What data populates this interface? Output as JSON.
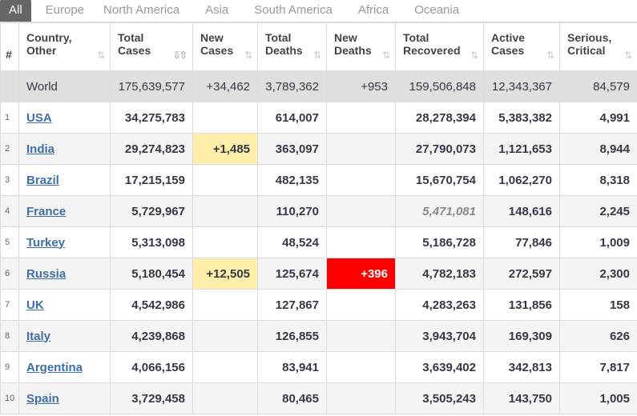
{
  "tabs": [
    "All",
    "Europe",
    "North America",
    "Asia",
    "South America",
    "Africa",
    "Oceania"
  ],
  "headers": {
    "idx": "#",
    "country": [
      "Country,",
      "Other"
    ],
    "total_cases": [
      "Total",
      "Cases"
    ],
    "new_cases": [
      "New",
      "Cases"
    ],
    "total_deaths": [
      "Total",
      "Deaths"
    ],
    "new_deaths": [
      "New",
      "Deaths"
    ],
    "total_recovered": [
      "Total",
      "Recovered"
    ],
    "active_cases": [
      "Active",
      "Cases"
    ],
    "serious": [
      "Serious,",
      "Critical"
    ]
  },
  "sort_icons": {
    "inactive": "⇅",
    "active": "⇩⇧"
  },
  "world": {
    "country": "World",
    "total_cases": "175,639,577",
    "new_cases": "+34,462",
    "total_deaths": "3,789,362",
    "new_deaths": "+953",
    "total_recovered": "159,506,848",
    "active_cases": "12,343,367",
    "serious": "84,579"
  },
  "rows": [
    {
      "idx": "1",
      "country": "USA",
      "total_cases": "34,275,783",
      "new_cases": "",
      "total_deaths": "614,007",
      "new_deaths": "",
      "total_recovered": "28,278,394",
      "active_cases": "5,383,382",
      "serious": "4,991"
    },
    {
      "idx": "2",
      "country": "India",
      "total_cases": "29,274,823",
      "new_cases": "+1,485",
      "total_deaths": "363,097",
      "new_deaths": "",
      "total_recovered": "27,790,073",
      "active_cases": "1,121,653",
      "serious": "8,944"
    },
    {
      "idx": "3",
      "country": "Brazil",
      "total_cases": "17,215,159",
      "new_cases": "",
      "total_deaths": "482,135",
      "new_deaths": "",
      "total_recovered": "15,670,754",
      "active_cases": "1,062,270",
      "serious": "8,318"
    },
    {
      "idx": "4",
      "country": "France",
      "total_cases": "5,729,967",
      "new_cases": "",
      "total_deaths": "110,270",
      "new_deaths": "",
      "total_recovered": "5,471,081",
      "active_cases": "148,616",
      "serious": "2,245"
    },
    {
      "idx": "5",
      "country": "Turkey",
      "total_cases": "5,313,098",
      "new_cases": "",
      "total_deaths": "48,524",
      "new_deaths": "",
      "total_recovered": "5,186,728",
      "active_cases": "77,846",
      "serious": "1,009"
    },
    {
      "idx": "6",
      "country": "Russia",
      "total_cases": "5,180,454",
      "new_cases": "+12,505",
      "total_deaths": "125,674",
      "new_deaths": "+396",
      "total_recovered": "4,782,183",
      "active_cases": "272,597",
      "serious": "2,300"
    },
    {
      "idx": "7",
      "country": "UK",
      "total_cases": "4,542,986",
      "new_cases": "",
      "total_deaths": "127,867",
      "new_deaths": "",
      "total_recovered": "4,283,263",
      "active_cases": "131,856",
      "serious": "158"
    },
    {
      "idx": "8",
      "country": "Italy",
      "total_cases": "4,239,868",
      "new_cases": "",
      "total_deaths": "126,855",
      "new_deaths": "",
      "total_recovered": "3,943,704",
      "active_cases": "169,309",
      "serious": "626"
    },
    {
      "idx": "9",
      "country": "Argentina",
      "total_cases": "4,066,156",
      "new_cases": "",
      "total_deaths": "83,941",
      "new_deaths": "",
      "total_recovered": "3,639,402",
      "active_cases": "342,813",
      "serious": "7,817"
    },
    {
      "idx": "10",
      "country": "Spain",
      "total_cases": "3,729,458",
      "new_cases": "",
      "total_deaths": "80,465",
      "new_deaths": "",
      "total_recovered": "3,505,243",
      "active_cases": "143,750",
      "serious": "1,005"
    }
  ],
  "colors": {
    "new_cases_highlight": "#ffeeaa",
    "new_deaths_highlight": "#ff0000",
    "link": "#3e6fa8"
  }
}
